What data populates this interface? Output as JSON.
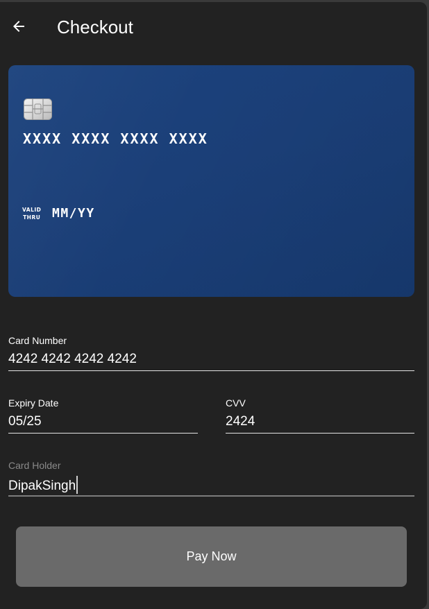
{
  "appbar": {
    "title": "Checkout",
    "back_icon": "arrow-left-icon"
  },
  "card_preview": {
    "number_placeholder": "XXXX XXXX XXXX XXXX",
    "valid_line1": "VALID",
    "valid_line2": "THRU",
    "expiry_placeholder": "MM/YY",
    "chip_icon": "card-chip-icon",
    "color": "#1b427d"
  },
  "form": {
    "card_number": {
      "label": "Card Number",
      "value": "4242 4242 4242 4242"
    },
    "expiry_date": {
      "label": "Expiry Date",
      "value": "05/25"
    },
    "cvv": {
      "label": "CVV",
      "value": "2424"
    },
    "card_holder": {
      "label": "Card Holder",
      "value": "DipakSingh"
    }
  },
  "actions": {
    "pay_label": "Pay Now"
  },
  "colors": {
    "background": "#222222",
    "button": "#6a6a6a",
    "card": "#1b427d"
  }
}
